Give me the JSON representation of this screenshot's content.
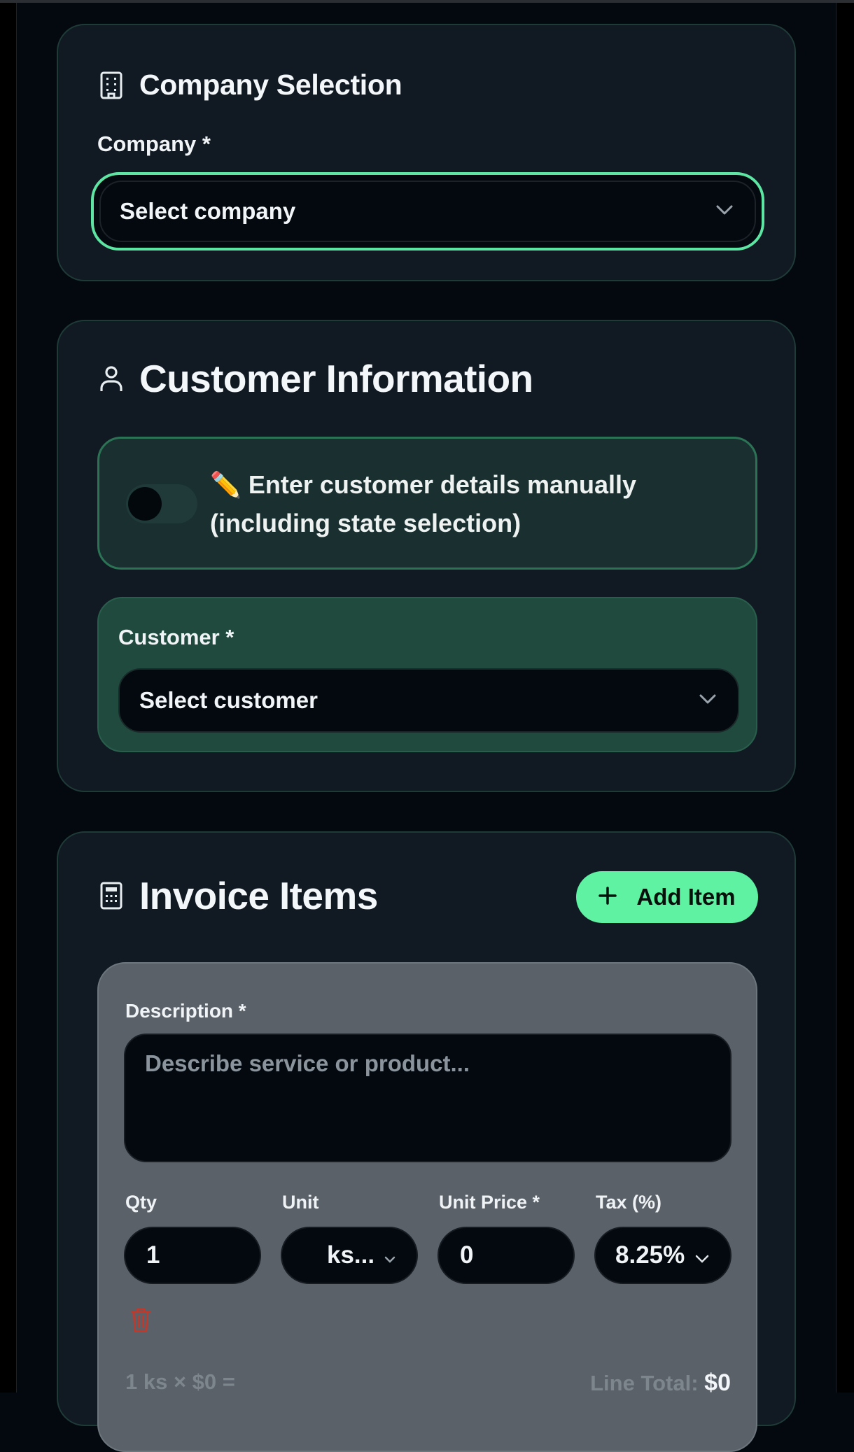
{
  "company_section": {
    "title": "Company Selection",
    "field_label": "Company *",
    "select_value": "Select company"
  },
  "customer_section": {
    "title": "Customer Information",
    "manual_toggle": {
      "enabled": false,
      "emoji": "✏️",
      "text": "Enter customer details manually (including state selection)"
    },
    "field_label": "Customer *",
    "select_value": "Select customer"
  },
  "items_section": {
    "title": "Invoice Items",
    "add_button_label": "Add Item",
    "item": {
      "description_label": "Description *",
      "description_placeholder": "Describe service or product...",
      "qty_label": "Qty",
      "qty_value": "1",
      "unit_label": "Unit",
      "unit_value": "ks...",
      "unit_price_label": "Unit Price *",
      "unit_price_value": "0",
      "tax_label": "Tax (%)",
      "tax_value": "8.25%",
      "summary_left": "1 ks × $0 =",
      "line_total_label": "Line Total:",
      "line_total_value": "$0"
    }
  },
  "colors": {
    "accent": "#5de6a3",
    "background": "#04090f",
    "card": "#111a22",
    "danger": "#c0392b"
  }
}
